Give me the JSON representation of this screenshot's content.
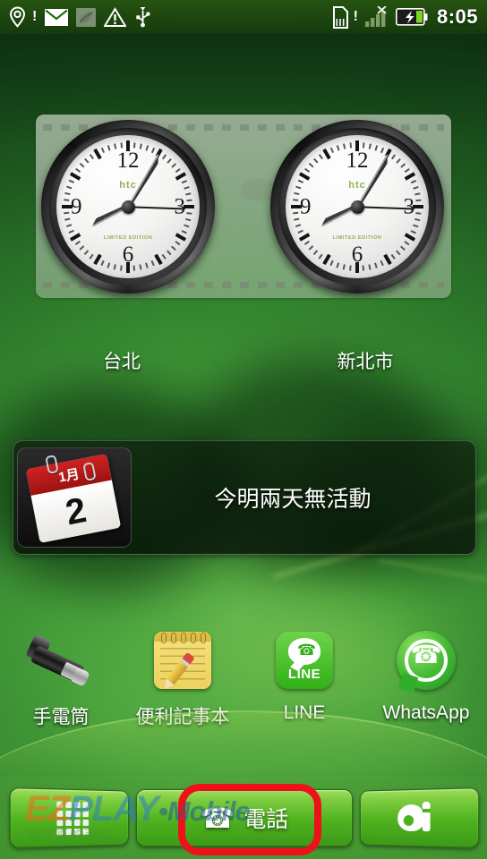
{
  "statusbar": {
    "time": "8:05",
    "left_icons": [
      {
        "name": "location-icon",
        "glyph": "location",
        "badge": "!"
      },
      {
        "name": "mail-icon",
        "glyph": "envelope",
        "badge": ""
      },
      {
        "name": "app-notification-icon",
        "glyph": "leaf",
        "badge": ""
      },
      {
        "name": "warning-icon",
        "glyph": "warning-triangle",
        "badge": ""
      },
      {
        "name": "usb-icon",
        "glyph": "usb",
        "badge": ""
      }
    ],
    "right_icons": [
      {
        "name": "sd-card-icon",
        "glyph": "sd-card",
        "badge": "!"
      },
      {
        "name": "signal-icon",
        "glyph": "signal-bars-no-service",
        "badge": "×"
      },
      {
        "name": "battery-charging-icon",
        "glyph": "battery-charging",
        "badge": ""
      }
    ]
  },
  "clock_widget": {
    "brand": "htc",
    "edition": "LIMITED EDITION",
    "numerals": {
      "n12": "12",
      "n3": "3",
      "n6": "6",
      "n9": "9"
    },
    "clocks": [
      {
        "city": "台北",
        "hour_deg": 242,
        "minute_deg": 30,
        "second_deg": 92
      },
      {
        "city": "新北市",
        "hour_deg": 242,
        "minute_deg": 30,
        "second_deg": 92
      }
    ]
  },
  "calendar_widget": {
    "month_label": "1月",
    "day_number": "2",
    "message": "今明兩天無活動"
  },
  "apps": [
    {
      "label": "手電筒",
      "icon": "flashlight-icon"
    },
    {
      "label": "便利記事本",
      "icon": "notepad-icon"
    },
    {
      "label": "LINE",
      "icon": "line-icon",
      "badge_text": "LINE"
    },
    {
      "label": "WhatsApp",
      "icon": "whatsapp-icon"
    }
  ],
  "dock": {
    "app_drawer": {
      "label": "",
      "icon": "app-grid-icon"
    },
    "phone": {
      "label": "電話",
      "icon": "phone-handset-icon"
    },
    "personalize": {
      "label": "",
      "icon": "paint-palette-icon"
    }
  },
  "annotation": {
    "target": "phone-dock-button",
    "color": "#ef1119"
  },
  "watermark": {
    "part1": "EZ",
    "part2": "PLAY",
    "part3": "•Mobile",
    "subtitle": "科技真的可以"
  },
  "theme": {
    "wallpaper": "green-leaf-macro",
    "accent_green": "#4fb21f",
    "annotation_red": "#ef1119",
    "brand_green": "#7ea33a"
  }
}
